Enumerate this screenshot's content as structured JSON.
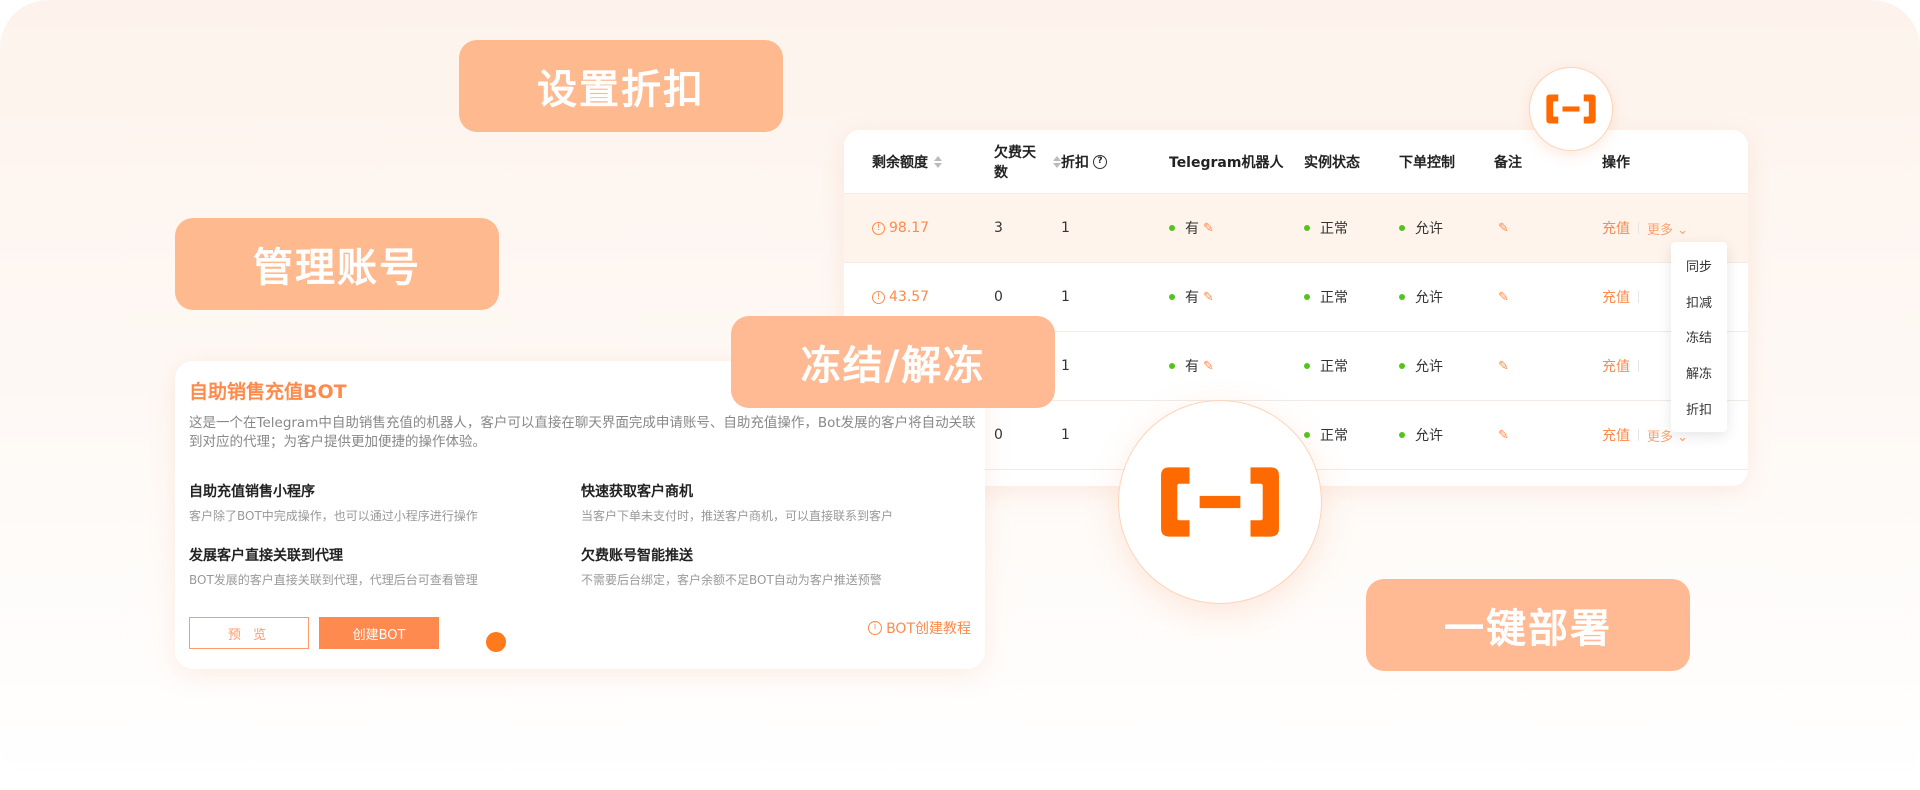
{
  "labels": {
    "discount": "设置折扣",
    "account": "管理账号",
    "freeze": "冻结/解冻",
    "deploy": "一键部署"
  },
  "table": {
    "headers": [
      "剩余额度",
      "欠费天数",
      "折扣",
      "Telegram机器人",
      "实例状态",
      "下单控制",
      "备注",
      "操作"
    ],
    "rows": [
      {
        "balance": "98.17",
        "days": "3",
        "discount": "1",
        "bot": "有",
        "status": "正常",
        "control": "允许",
        "action": "充值",
        "more": "更多"
      },
      {
        "balance": "43.57",
        "days": "0",
        "discount": "1",
        "bot": "有",
        "status": "正常",
        "control": "允许",
        "action": "充值",
        "more": ""
      },
      {
        "balance": "",
        "days": "",
        "discount": "1",
        "bot": "有",
        "status": "正常",
        "control": "允许",
        "action": "充值",
        "more": ""
      },
      {
        "balance": "",
        "days": "0",
        "discount": "1",
        "bot": "",
        "status": "正常",
        "control": "允许",
        "action": "充值",
        "more": "更多"
      }
    ]
  },
  "dropdown": [
    "同步",
    "扣减",
    "冻结",
    "解冻",
    "折扣"
  ],
  "card": {
    "title": "自助销售充值BOT",
    "description": "这是一个在Telegram中自助销售充值的机器人，客户可以直接在聊天界面完成申请账号、自助充值操作，Bot发展的客户将自动关联到对应的代理；为客户提供更加便捷的操作体验。",
    "features": [
      {
        "title": "自助充值销售小程序",
        "desc": "客户除了BOT中完成操作，也可以通过小程序进行操作"
      },
      {
        "title": "快速获取客户商机",
        "desc": "当客户下单未支付时，推送客户商机，可以直接联系到客户"
      },
      {
        "title": "发展客户直接关联到代理",
        "desc": "BOT发展的客户直接关联到代理，代理后台可查看管理"
      },
      {
        "title": "欠费账号智能推送",
        "desc": "不需要后台绑定，客户余额不足BOT自动为客户推送预警"
      }
    ],
    "preview_btn": "预 览",
    "create_btn": "创建BOT",
    "tutorial": "BOT创建教程"
  },
  "colors": {
    "accent": "#ff8a4c",
    "pill": "#ffb98e",
    "logo": "#ff6a00",
    "status_green": "#52c41a"
  }
}
